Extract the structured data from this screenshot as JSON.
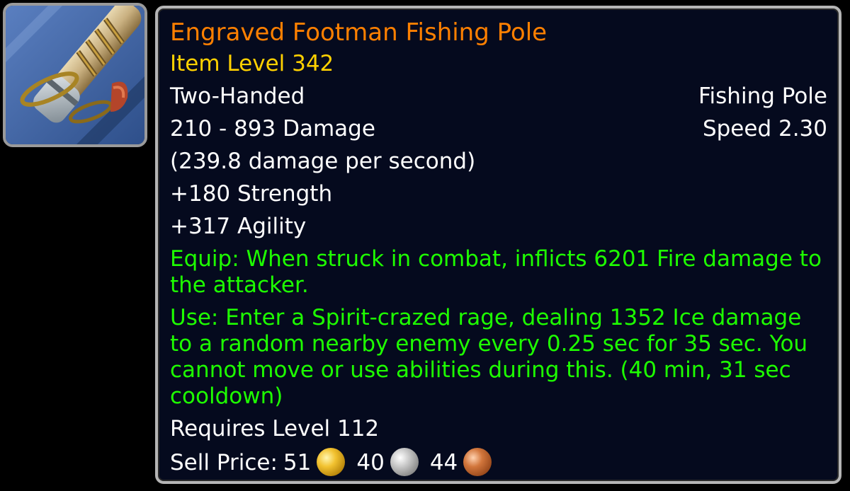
{
  "item": {
    "icon": "fishing-pole-icon",
    "name": "Engraved Footman Fishing Pole",
    "item_level": "Item Level 342",
    "slot": "Two-Handed",
    "type": "Fishing Pole",
    "damage": "210 - 893 Damage",
    "speed": "Speed 2.30",
    "dps": "(239.8 damage per second)",
    "stats": [
      "+180 Strength",
      "+317 Agility"
    ],
    "equip": "Equip: When struck in combat, inflicts 6201 Fire damage to the attacker.",
    "use": "Use: Enter a Spirit-crazed rage, dealing 1352 Ice damage to a random nearby enemy every 0.25 sec for 35 sec. You cannot move or use abilities during this. (40 min, 31 sec cooldown)",
    "requires": "Requires Level 112",
    "sell_label": "Sell Price:",
    "gold": "51",
    "silver": "40",
    "copper": "44"
  },
  "colors": {
    "name_legendary": "#ff8000",
    "item_level": "#ffd100",
    "effect_green": "#1eff00",
    "text": "#ffffff",
    "tooltip_bg": "#050a1e",
    "border": "#b5b5b5"
  }
}
